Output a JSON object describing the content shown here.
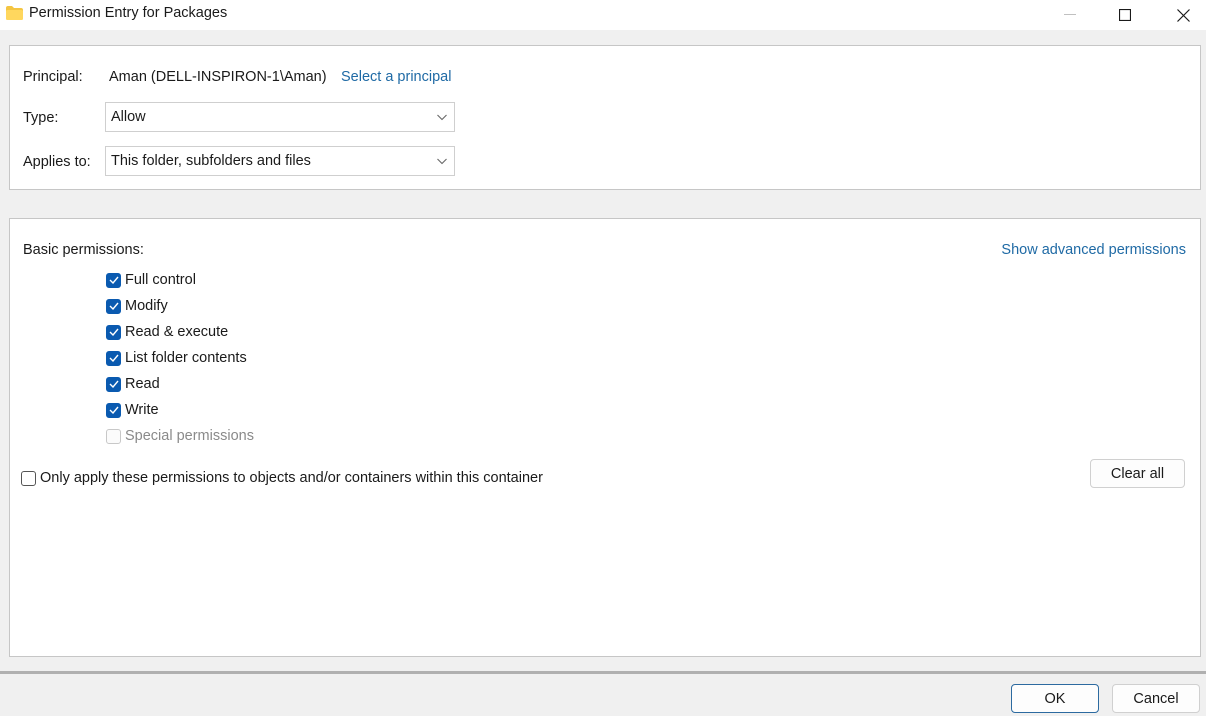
{
  "window": {
    "title": "Permission Entry for Packages",
    "icon": "folder-icon",
    "controls": [
      "minimize",
      "maximize",
      "close"
    ]
  },
  "principal_section": {
    "principal_label": "Principal:",
    "principal_value": "Aman (DELL-INSPIRON-1\\Aman)",
    "select_principal_link": "Select a principal",
    "type_label": "Type:",
    "type_value": "Allow",
    "applies_to_label": "Applies to:",
    "applies_to_value": "This folder, subfolders and files"
  },
  "permissions_section": {
    "heading": "Basic permissions:",
    "show_advanced_link": "Show advanced permissions",
    "permissions": [
      {
        "label": "Full control",
        "checked": true,
        "enabled": true
      },
      {
        "label": "Modify",
        "checked": true,
        "enabled": true
      },
      {
        "label": "Read & execute",
        "checked": true,
        "enabled": true
      },
      {
        "label": "List folder contents",
        "checked": true,
        "enabled": true
      },
      {
        "label": "Read",
        "checked": true,
        "enabled": true
      },
      {
        "label": "Write",
        "checked": true,
        "enabled": true
      },
      {
        "label": "Special permissions",
        "checked": false,
        "enabled": false
      }
    ],
    "only_apply_label": "Only apply these permissions to objects and/or containers within this container",
    "only_apply_checked": false,
    "clear_all_label": "Clear all"
  },
  "footer": {
    "ok_label": "OK",
    "cancel_label": "Cancel"
  },
  "colors": {
    "accent": "#0a5ab0",
    "link": "#1f6aa5",
    "background": "#f0f0f0"
  }
}
